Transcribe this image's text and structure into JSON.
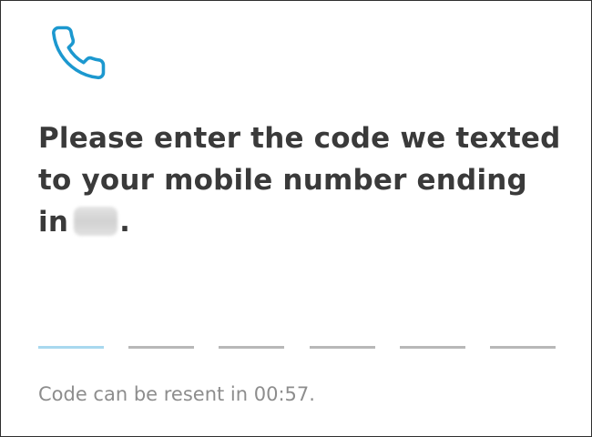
{
  "header": {
    "icon": "phone-icon",
    "icon_color": "#1c98cf"
  },
  "prompt": {
    "text": "Please enter the code we texted to your mobile number ending in",
    "end_punctuation": "."
  },
  "code_input": {
    "digit_count": 6,
    "digits": [
      "",
      "",
      "",
      "",
      "",
      ""
    ],
    "active_index": 0,
    "active_color": "#a8d8ef",
    "inactive_color": "#b8b8b8"
  },
  "resend": {
    "text": "Code can be resent in 00:57."
  }
}
